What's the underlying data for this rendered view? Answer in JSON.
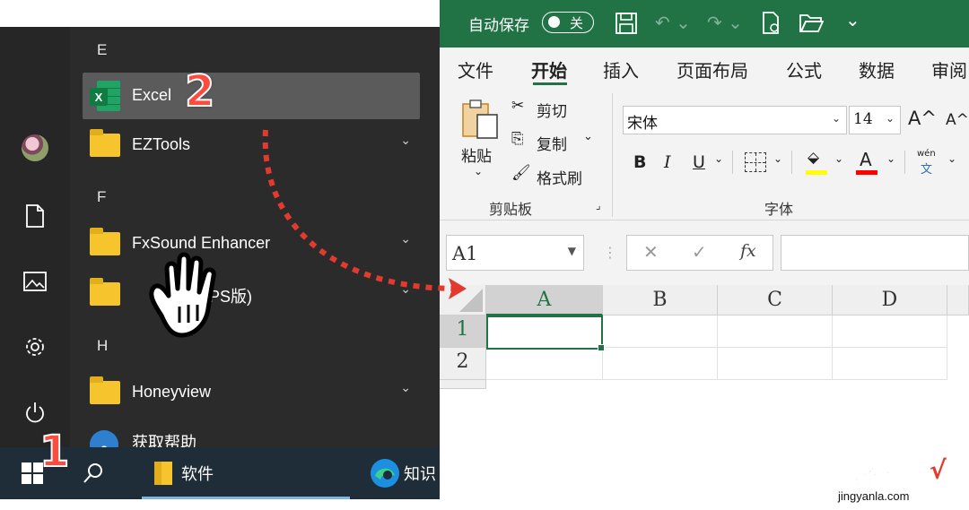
{
  "start_menu": {
    "rail_icons": [
      "user-avatar",
      "document-icon",
      "pictures-icon",
      "settings-gear-icon",
      "power-icon"
    ],
    "sections": [
      {
        "letter": "E",
        "apps": [
          {
            "label": "Excel",
            "icon": "excel-icon",
            "selected": true
          },
          {
            "label": "EZTools",
            "icon": "folder-icon",
            "expandable": true
          }
        ]
      },
      {
        "letter": "F",
        "apps": [
          {
            "label": "FxSound Enhancer",
            "icon": "folder-icon",
            "expandable": true
          },
          {
            "label": "/PS版)",
            "icon": "folder-icon",
            "expandable": true
          }
        ]
      },
      {
        "letter": "H",
        "apps": [
          {
            "label": "Honeyview",
            "icon": "folder-icon",
            "expandable": true
          },
          {
            "label": "获取帮助",
            "icon": "help-icon"
          }
        ]
      }
    ],
    "chevron": "⌄"
  },
  "taskbar": {
    "items": [
      {
        "label": "",
        "icon": "windows-start-icon"
      },
      {
        "label": "",
        "icon": "search-icon"
      },
      {
        "label": "软件",
        "icon": "folder-icon"
      },
      {
        "label": "知识",
        "icon": "edge-browser-icon"
      }
    ]
  },
  "excel": {
    "titlebar": {
      "autosave_label": "自动保存",
      "autosave_state": "关",
      "quick_access": [
        "save-icon",
        "undo-icon",
        "redo-icon",
        "print-preview-icon",
        "open-folder-icon",
        "customize-dropdown-icon"
      ]
    },
    "tabs": [
      {
        "label": "文件",
        "active": false
      },
      {
        "label": "开始",
        "active": true
      },
      {
        "label": "插入",
        "active": false
      },
      {
        "label": "页面布局",
        "active": false
      },
      {
        "label": "公式",
        "active": false
      },
      {
        "label": "数据",
        "active": false
      },
      {
        "label": "审阅",
        "active": false
      }
    ],
    "clipboard": {
      "paste": "粘贴",
      "cut": "剪切",
      "copy": "复制",
      "format_painter": "格式刷",
      "group_label": "剪贴板"
    },
    "font": {
      "font_name": "宋体",
      "font_size": "14",
      "grow": "A^",
      "shrink": "A^",
      "bold": "B",
      "italic": "I",
      "underline": "U",
      "phonetic_top": "wén",
      "phonetic_bottom": "文",
      "group_label": "字体",
      "fill_color": "#ffff00",
      "font_color": "#ff0000"
    },
    "formula_bar": {
      "name_box": "A1",
      "cancel": "✕",
      "enter": "✓",
      "fx": "fx",
      "value": ""
    },
    "grid": {
      "columns": [
        "A",
        "B",
        "C",
        "D"
      ],
      "rows": [
        "1",
        "2"
      ],
      "selected_cell": "A1"
    }
  },
  "annotations": {
    "step1": "1",
    "step2": "2"
  },
  "watermark": {
    "title": "经验啦",
    "check": "√",
    "url": "jingyanla.com"
  },
  "colors": {
    "excel_green": "#217346",
    "start_bg": "#2b2b2b",
    "taskbar_bg": "#1f2d38",
    "annotation_red": "#ff4b3e"
  }
}
